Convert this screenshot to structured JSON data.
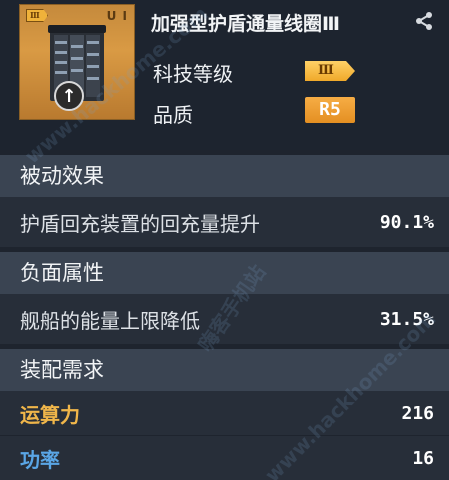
{
  "item": {
    "title": "加强型护盾通量线圈Ⅲ",
    "icon_name": "shield-flux-coil-icon",
    "icon_tier": "Ⅲ",
    "icon_corner_label": "U I",
    "tech_level_label": "科技等级",
    "tech_level_value": "Ⅲ",
    "quality_label": "品质",
    "quality_value": "R5"
  },
  "sections": {
    "passive": {
      "title": "被动效果",
      "rows": [
        {
          "label": "护盾回充装置的回充量提升",
          "value": "90.1%"
        }
      ]
    },
    "negative": {
      "title": "负面属性",
      "rows": [
        {
          "label": "舰船的能量上限降低",
          "value": "31.5%"
        }
      ]
    },
    "requirements": {
      "title": "装配需求",
      "rows": [
        {
          "label": "运算力",
          "value": "216"
        },
        {
          "label": "功率",
          "value": "16"
        }
      ]
    }
  },
  "colors": {
    "background": "#1e242e",
    "section_header": "#3a4452",
    "row": "#272e39",
    "compute": "#f0b64a",
    "power": "#5aa6e6",
    "badge": "#f0a92a"
  },
  "watermarks": [
    "www.hackhome.com",
    "嗨客手机站"
  ]
}
